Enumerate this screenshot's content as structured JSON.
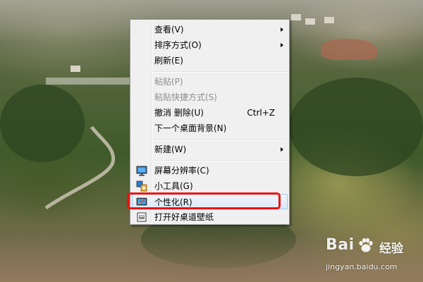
{
  "menu": {
    "items": [
      {
        "label": "查看(V)",
        "submenu": true
      },
      {
        "label": "排序方式(O)",
        "submenu": true
      },
      {
        "label": "刷新(E)"
      },
      {
        "label": "粘贴(P)",
        "disabled": true
      },
      {
        "label": "粘贴快捷方式(S)",
        "disabled": true
      },
      {
        "label": "撤消 删除(U)",
        "shortcut": "Ctrl+Z"
      },
      {
        "label": "下一个桌面背景(N)"
      },
      {
        "label": "新建(W)",
        "submenu": true
      },
      {
        "label": "屏幕分辨率(C)",
        "icon": "display-resolution-icon"
      },
      {
        "label": "小工具(G)",
        "icon": "gadgets-icon"
      },
      {
        "label": "个性化(R)",
        "icon": "personalize-icon",
        "highlighted": true
      },
      {
        "label": "打开好桌道壁纸",
        "icon": "wallpaper-app-icon"
      }
    ]
  },
  "annotation": {
    "color": "#ee1212"
  },
  "watermark": {
    "brand": "Bai",
    "brand2": "经验",
    "url": "jingyan.baidu.com"
  }
}
